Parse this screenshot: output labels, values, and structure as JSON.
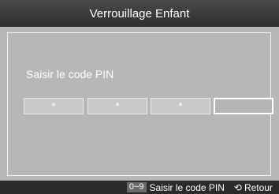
{
  "title": "Verrouillage Enfant",
  "prompt": "Saisir le code PIN",
  "pin": {
    "digits": [
      {
        "value": "*",
        "state": "filled"
      },
      {
        "value": "*",
        "state": "filled"
      },
      {
        "value": "*",
        "state": "filled"
      },
      {
        "value": "",
        "state": "active"
      }
    ]
  },
  "footer": {
    "key_label": "0~9",
    "key_hint": "Saisir le code PIN",
    "return_icon": "return-icon",
    "return_label": "Retour"
  },
  "colors": {
    "background": "#b7b7b7",
    "title_bar": "#3a3a3a",
    "footer_bar": "#2a2a2a"
  }
}
